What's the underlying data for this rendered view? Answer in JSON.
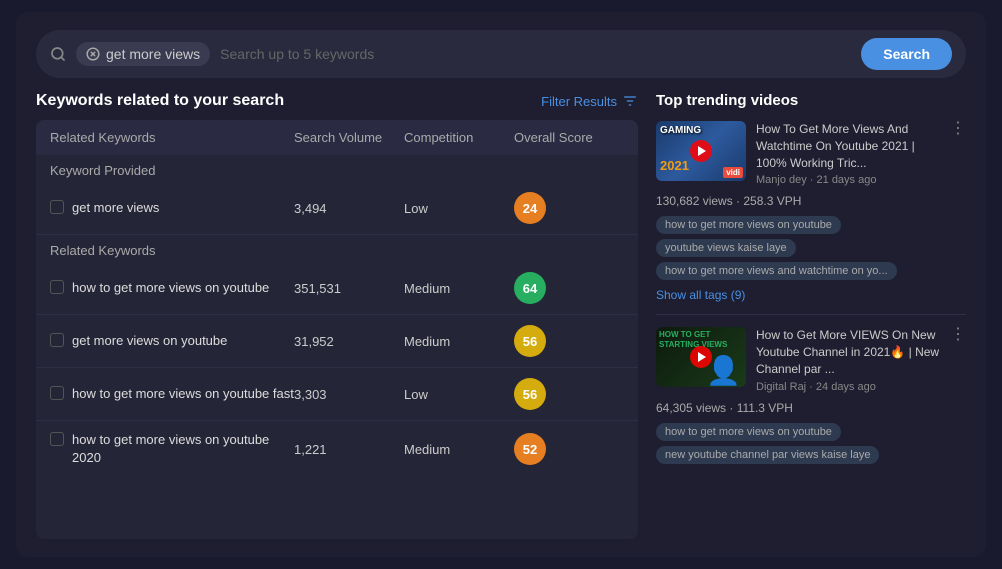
{
  "search": {
    "tag": "get more views",
    "placeholder": "Search up to 5 keywords",
    "button_label": "Search"
  },
  "left_panel": {
    "title": "Keywords related to your search",
    "filter_label": "Filter Results",
    "table": {
      "columns": [
        "Related Keywords",
        "Search Volume",
        "Competition",
        "Overall Score"
      ],
      "section1_label": "Keyword Provided",
      "section1_rows": [
        {
          "keyword": "get more views",
          "volume": "3,494",
          "competition": "Low",
          "score": "24",
          "score_color": "orange"
        }
      ],
      "section2_label": "Related Keywords",
      "section2_rows": [
        {
          "keyword": "how to get more views on youtube",
          "volume": "351,531",
          "competition": "Medium",
          "score": "64",
          "score_color": "green"
        },
        {
          "keyword": "get more views on youtube",
          "volume": "31,952",
          "competition": "Medium",
          "score": "56",
          "score_color": "yellow"
        },
        {
          "keyword": "how to get more views on youtube fast",
          "volume": "3,303",
          "competition": "Low",
          "score": "56",
          "score_color": "yellow"
        },
        {
          "keyword": "how to get more views on youtube 2020",
          "volume": "1,221",
          "competition": "Medium",
          "score": "52",
          "score_color": "orange"
        }
      ]
    }
  },
  "right_panel": {
    "title": "Top trending videos",
    "videos": [
      {
        "thumb_type": "gaming",
        "thumb_label": "GAMING",
        "thumb_year": "2021",
        "title": "How To Get More Views And Watchtime On Youtube 2021 | 100% Working Tric...",
        "author": "Manjo dey",
        "time_ago": "21 days ago",
        "views": "130,682 views",
        "vph": "258.3 VPH",
        "tags": [
          "how to get more views on youtube",
          "youtube views kaise laye",
          "how to get more views and watchtime on yo..."
        ],
        "show_all_label": "Show all tags (9)"
      },
      {
        "thumb_type": "howto",
        "thumb_label": "HOW TO GET\nSTARTING VIEWS",
        "title": "How to Get More VIEWS On New Youtube Channel in 2021🔥 | New Channel par ...",
        "author": "Digital Raj",
        "time_ago": "24 days ago",
        "views": "64,305 views",
        "vph": "111.3 VPH",
        "tags": [
          "how to get more views on youtube",
          "new youtube channel par views kaise laye"
        ]
      }
    ]
  }
}
